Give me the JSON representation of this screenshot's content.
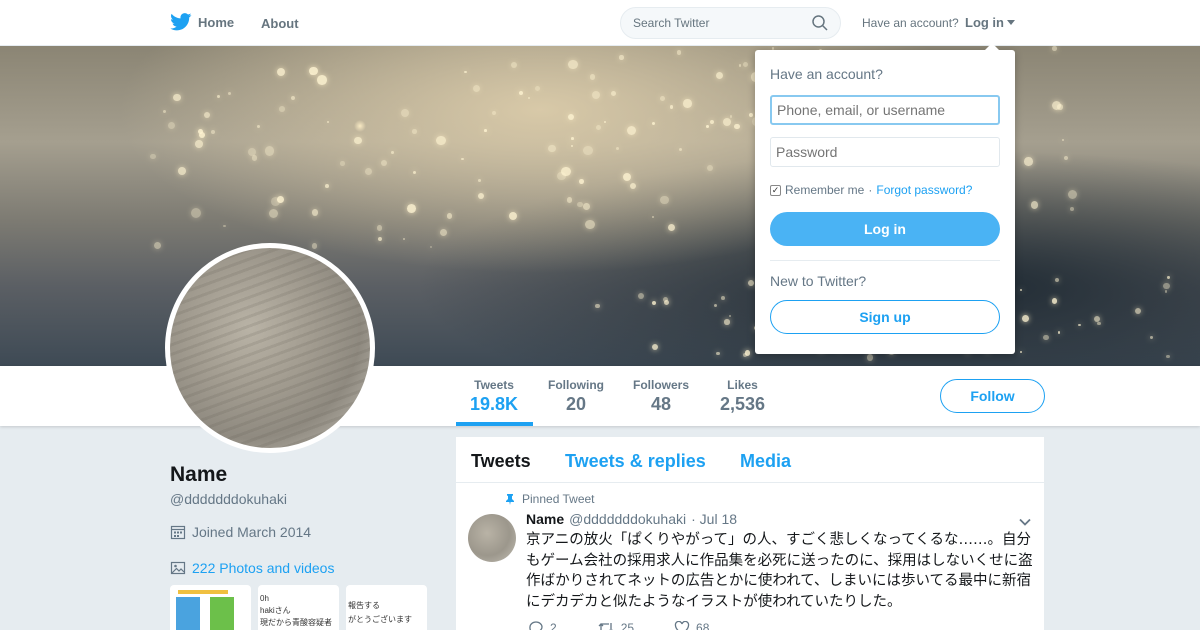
{
  "colors": {
    "accent": "#1da1f2",
    "text": "#14171a",
    "muted": "#657786",
    "background": "#e6ecf0"
  },
  "nav": {
    "home_label": "Home",
    "about_label": "About",
    "search_placeholder": "Search Twitter",
    "have_account": "Have an account?",
    "login_label": "Log in"
  },
  "login_dropdown": {
    "title": "Have an account?",
    "username_placeholder": "Phone, email, or username",
    "password_placeholder": "Password",
    "remember_me": "Remember me",
    "separator": "·",
    "forgot_password": "Forgot password?",
    "remember_checked": true,
    "login_button": "Log in",
    "new_to_twitter": "New to Twitter?",
    "signup_button": "Sign up"
  },
  "profile": {
    "name": "Name",
    "handle": "@dddddddokuhaki",
    "joined": "Joined March 2014",
    "photos": "222 Photos and videos"
  },
  "stats": [
    {
      "label": "Tweets",
      "value": "19.8K",
      "active": true
    },
    {
      "label": "Following",
      "value": "20"
    },
    {
      "label": "Followers",
      "value": "48"
    },
    {
      "label": "Likes",
      "value": "2,536"
    }
  ],
  "follow_button": "Follow",
  "tabs": [
    {
      "label": "Tweets",
      "active": true
    },
    {
      "label": "Tweets & replies"
    },
    {
      "label": "Media"
    }
  ],
  "tweet": {
    "pinned_label": "Pinned Tweet",
    "author_name": "Name",
    "author_handle": "@dddddddokuhaki",
    "date": "· Jul 18",
    "text": "京アニの放火「ぱくりやがって」の人、すごく悲しくなってくるな……。自分もゲーム会社の採用求人に作品集を必死に送ったのに、採用はしないくせに盗作ばかりされてネットの広告とかに使われて、しまいには歩いてる最中に新宿にデカデカと似たようなイラストが使われていたりした。",
    "replies": "2",
    "retweets": "25",
    "likes": "68"
  },
  "thumbnails": [
    {
      "text": ""
    },
    {
      "text": "0h\nhakiさん\n現だから青酸容疑者の"
    },
    {
      "text": "報告する\nがとうございます"
    }
  ]
}
